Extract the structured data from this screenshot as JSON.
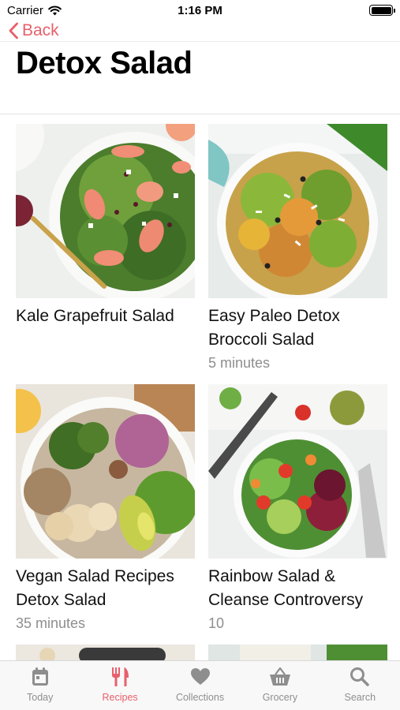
{
  "status_bar": {
    "carrier": "Carrier",
    "time": "1:16 PM"
  },
  "nav": {
    "back_label": "Back"
  },
  "page": {
    "title": "Detox Salad"
  },
  "recipes": [
    {
      "title": "Kale Grapefruit Salad",
      "meta": ""
    },
    {
      "title": "Easy Paleo Detox Broccoli Salad",
      "meta": "5 minutes"
    },
    {
      "title": "Vegan Salad Recipes Detox Salad",
      "meta": "35 minutes"
    },
    {
      "title": "Rainbow Salad & Cleanse Controversy",
      "meta": "10"
    }
  ],
  "tabs": [
    {
      "label": "Today",
      "icon": "calendar-icon",
      "active": false
    },
    {
      "label": "Recipes",
      "icon": "fork-knife-icon",
      "active": true
    },
    {
      "label": "Collections",
      "icon": "heart-icon",
      "active": false
    },
    {
      "label": "Grocery",
      "icon": "basket-icon",
      "active": false
    },
    {
      "label": "Search",
      "icon": "search-icon",
      "active": false
    }
  ],
  "colors": {
    "accent": "#e8606c",
    "inactive": "#8e8e8e",
    "tab_bg": "#f8f8f8"
  }
}
